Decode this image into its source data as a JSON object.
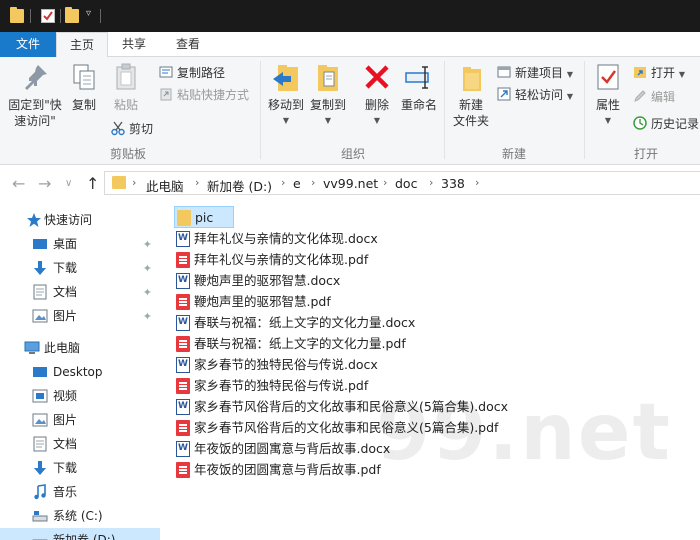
{
  "window": {
    "quick_access_icons": [
      "folder-icon",
      "properties-check-icon",
      "new-folder-icon",
      "customize-dropdown-icon"
    ]
  },
  "tabs": [
    {
      "label": "文件"
    },
    {
      "label": "主页"
    },
    {
      "label": "共享"
    },
    {
      "label": "查看"
    }
  ],
  "ribbon": {
    "clipboard": {
      "group_label": "剪贴板",
      "pin_quick_access": "固定到\"快\n速访问\"",
      "copy": "复制",
      "paste": "粘贴",
      "copy_path": "复制路径",
      "paste_shortcut": "粘贴快捷方式",
      "cut": "剪切"
    },
    "organize": {
      "group_label": "组织",
      "move_to": "移动到",
      "copy_to": "复制到",
      "delete": "删除",
      "rename": "重命名"
    },
    "new": {
      "group_label": "新建",
      "new_folder": "新建\n文件夹",
      "new_item": "新建项目",
      "easy_access": "轻松访问"
    },
    "open": {
      "group_label": "打开",
      "properties": "属性",
      "open": "打开",
      "edit": "编辑",
      "history": "历史记录"
    }
  },
  "address": {
    "crumbs": [
      "此电脑",
      "新加卷 (D:)",
      "e",
      "vv99.net",
      "doc",
      "338"
    ]
  },
  "nav_pane": {
    "quick_access": "快速访问",
    "quick_items": [
      "桌面",
      "下载",
      "文档",
      "图片"
    ],
    "this_pc": "此电脑",
    "pc_items": [
      "Desktop",
      "视频",
      "图片",
      "文档",
      "下载",
      "音乐",
      "系统 (C:)",
      "新加卷 (D:)"
    ]
  },
  "files": [
    {
      "name": "pic",
      "type": "folder"
    },
    {
      "name": "拜年礼仪与亲情的文化体现.docx",
      "type": "docx"
    },
    {
      "name": "拜年礼仪与亲情的文化体现.pdf",
      "type": "pdf"
    },
    {
      "name": "鞭炮声里的驱邪智慧.docx",
      "type": "docx"
    },
    {
      "name": "鞭炮声里的驱邪智慧.pdf",
      "type": "pdf"
    },
    {
      "name": "春联与祝福：纸上文字的文化力量.docx",
      "type": "docx"
    },
    {
      "name": "春联与祝福：纸上文字的文化力量.pdf",
      "type": "pdf"
    },
    {
      "name": "家乡春节的独特民俗与传说.docx",
      "type": "docx"
    },
    {
      "name": "家乡春节的独特民俗与传说.pdf",
      "type": "pdf"
    },
    {
      "name": "家乡春节风俗背后的文化故事和民俗意义(5篇合集).docx",
      "type": "docx"
    },
    {
      "name": "家乡春节风俗背后的文化故事和民俗意义(5篇合集).pdf",
      "type": "pdf"
    },
    {
      "name": "年夜饭的团圆寓意与背后故事.docx",
      "type": "docx"
    },
    {
      "name": "年夜饭的团圆寓意与背后故事.pdf",
      "type": "pdf"
    }
  ],
  "watermark": "99.net",
  "colors": {
    "file_tab": "#1979ca",
    "selection": "#cce8ff",
    "folder": "#f3c95f",
    "pdf": "#e8383d",
    "word": "#2b579a",
    "delete_x": "#e81123"
  }
}
